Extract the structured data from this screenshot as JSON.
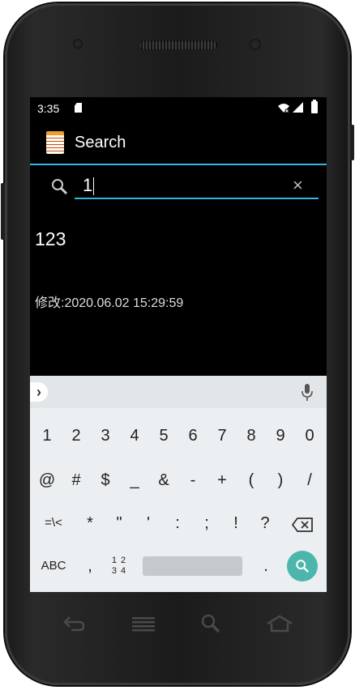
{
  "status_bar": {
    "time": "3:35",
    "icons": [
      "sd-card-icon",
      "wifi-icon",
      "signal-icon",
      "battery-icon"
    ]
  },
  "action_bar": {
    "title": "Search",
    "icon": "notepad-icon"
  },
  "search": {
    "value": "1",
    "icons": [
      "search-icon",
      "clear-icon"
    ],
    "clear_glyph": "×"
  },
  "result": {
    "title": "123",
    "modified": "修改:2020.06.02 15:29:59"
  },
  "keyboard": {
    "row1": [
      "1",
      "2",
      "3",
      "4",
      "5",
      "6",
      "7",
      "8",
      "9",
      "0"
    ],
    "row2": [
      "@",
      "#",
      "$",
      "_",
      "&",
      "-",
      "+",
      "(",
      ")",
      "/"
    ],
    "row3": [
      "=\\<",
      "*",
      "\"",
      "'",
      ":",
      ";",
      "!",
      "?"
    ],
    "row4": {
      "abc": "ABC",
      "comma": ",",
      "numpad_top": "1 2",
      "numpad_bottom": "3 4",
      "period": "."
    },
    "chevron": "›"
  },
  "colors": {
    "accent": "#33b5e5",
    "search_key": "#4db6ac",
    "keyboard_bg": "#eceff1"
  },
  "nav_icons": [
    "back-icon",
    "menu-icon",
    "search-icon",
    "home-icon"
  ]
}
